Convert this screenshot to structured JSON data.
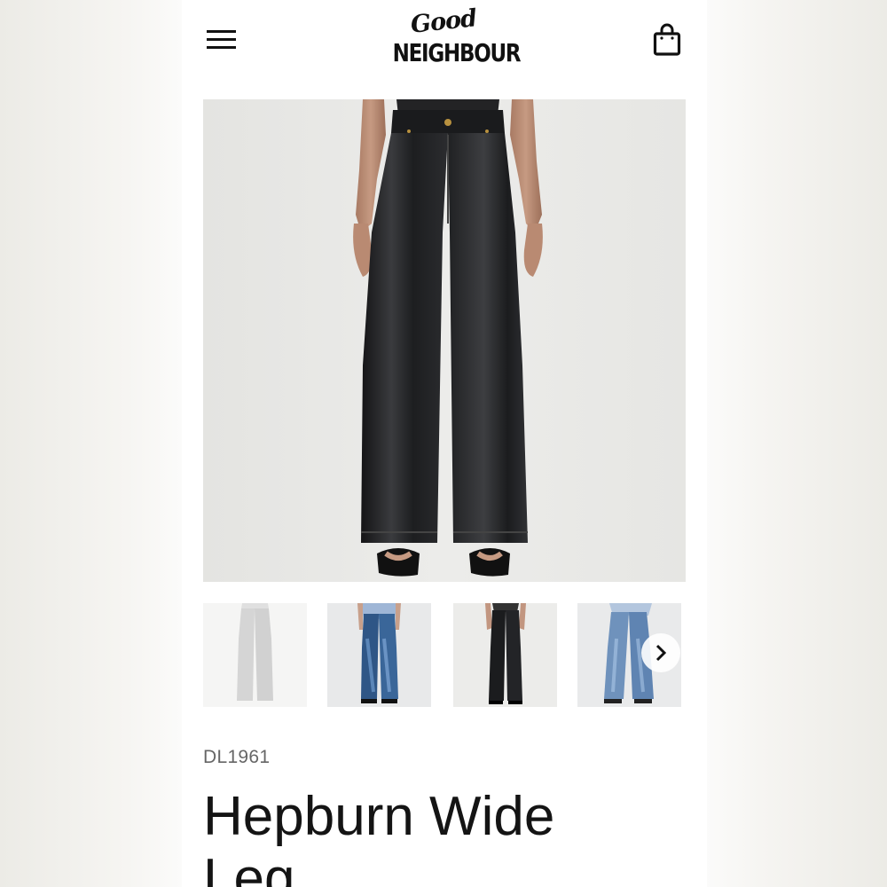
{
  "header": {
    "menu_icon": "hamburger-menu-icon",
    "logo_script": "Good",
    "logo_block": "NEIGHBOUR",
    "cart_icon": "shopping-bag-icon"
  },
  "gallery": {
    "main_image": "black coated wide leg jeans",
    "thumbnails": [
      {
        "alt": "light grey wide leg jeans"
      },
      {
        "alt": "medium blue wide leg jeans"
      },
      {
        "alt": "black wide leg jeans"
      },
      {
        "alt": "light blue wide leg jeans"
      }
    ],
    "next_icon": "chevron-right-icon"
  },
  "product": {
    "brand": "DL1961",
    "title": "Hepburn Wide Leg"
  },
  "colors": {
    "background": "#ffffff",
    "text": "#141414",
    "muted": "#666666"
  }
}
